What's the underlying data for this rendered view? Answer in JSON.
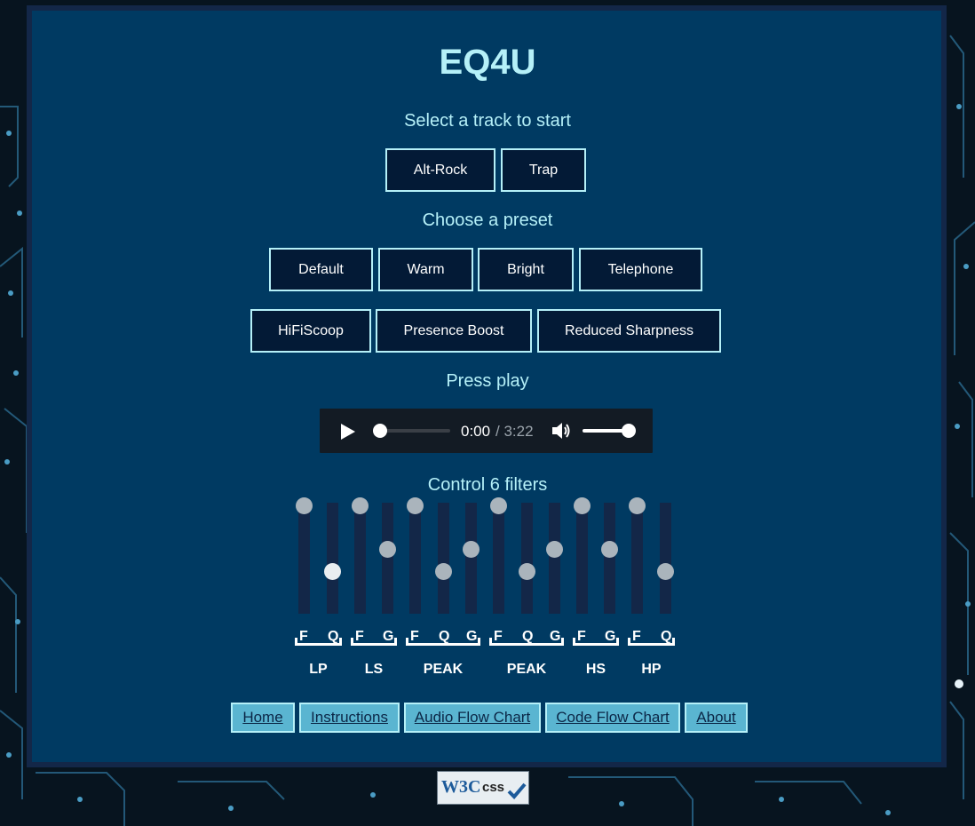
{
  "app": {
    "title": "EQ4U"
  },
  "tracks": {
    "heading": "Select a track to start",
    "items": [
      "Alt-Rock",
      "Trap"
    ]
  },
  "presets": {
    "heading": "Choose a preset",
    "row1": [
      "Default",
      "Warm",
      "Bright",
      "Telephone"
    ],
    "row2": [
      "HiFiScoop",
      "Presence Boost",
      "Reduced Sharpness"
    ]
  },
  "player": {
    "heading": "Press play",
    "current_time": "0:00",
    "duration": "/ 3:22",
    "progress": 0,
    "volume": 1
  },
  "filters": {
    "heading": "Control 6 filters",
    "controls": [
      {
        "label": "F",
        "level": 1.0
      },
      {
        "label": "Q",
        "level": 0.25
      },
      {
        "label": "F",
        "level": 1.0
      },
      {
        "label": "G",
        "level": 0.5
      },
      {
        "label": "F",
        "level": 1.0
      },
      {
        "label": "Q",
        "level": 0.25
      },
      {
        "label": "G",
        "level": 0.5
      },
      {
        "label": "F",
        "level": 1.0
      },
      {
        "label": "Q",
        "level": 0.25
      },
      {
        "label": "G",
        "level": 0.5
      },
      {
        "label": "F",
        "level": 1.0
      },
      {
        "label": "G",
        "level": 0.5
      },
      {
        "label": "F",
        "level": 1.0
      },
      {
        "label": "Q",
        "level": 0.25
      }
    ],
    "groups": [
      "LP",
      "LS",
      "PEAK",
      "PEAK",
      "HS",
      "HP"
    ]
  },
  "nav": {
    "items": [
      "Home",
      "Instructions",
      "Audio Flow Chart",
      "Code Flow Chart",
      "About"
    ]
  },
  "badge": {
    "brand": "W3C",
    "label": "css"
  },
  "colors": {
    "panel": "#003a62",
    "accent": "#b5f0f8",
    "button": "#031a36",
    "nav": "#5ab5d1"
  }
}
